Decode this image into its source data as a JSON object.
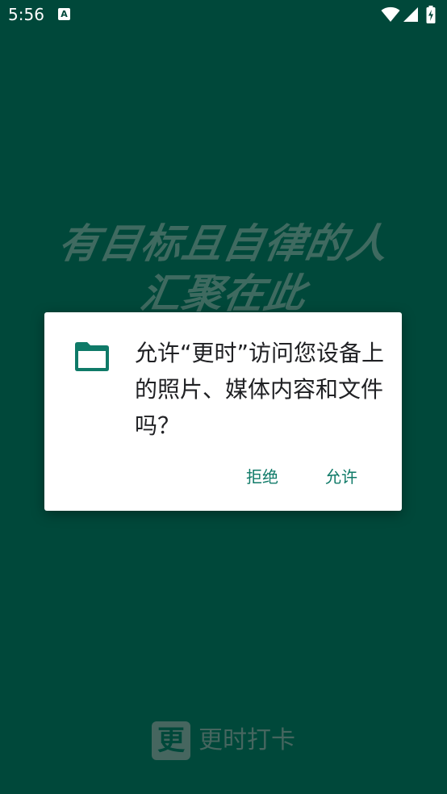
{
  "status_bar": {
    "time": "5:56",
    "notification_icon": "A",
    "icons": [
      "wifi-icon",
      "signal-icon",
      "battery-charging-icon"
    ]
  },
  "background": {
    "slogan_line1": "有目标且自律的人",
    "slogan_line2": "汇聚在此"
  },
  "brand": {
    "logo_char": "更",
    "name": "更时打卡"
  },
  "dialog": {
    "icon": "folder-icon",
    "message": "允许“更时”访问您设备上的照片、媒体内容和文件吗？",
    "deny_label": "拒绝",
    "allow_label": "允许"
  },
  "colors": {
    "background": "#00483a",
    "accent": "#0f7a68",
    "dialog_bg": "#ffffff",
    "muted": "#46665f"
  }
}
